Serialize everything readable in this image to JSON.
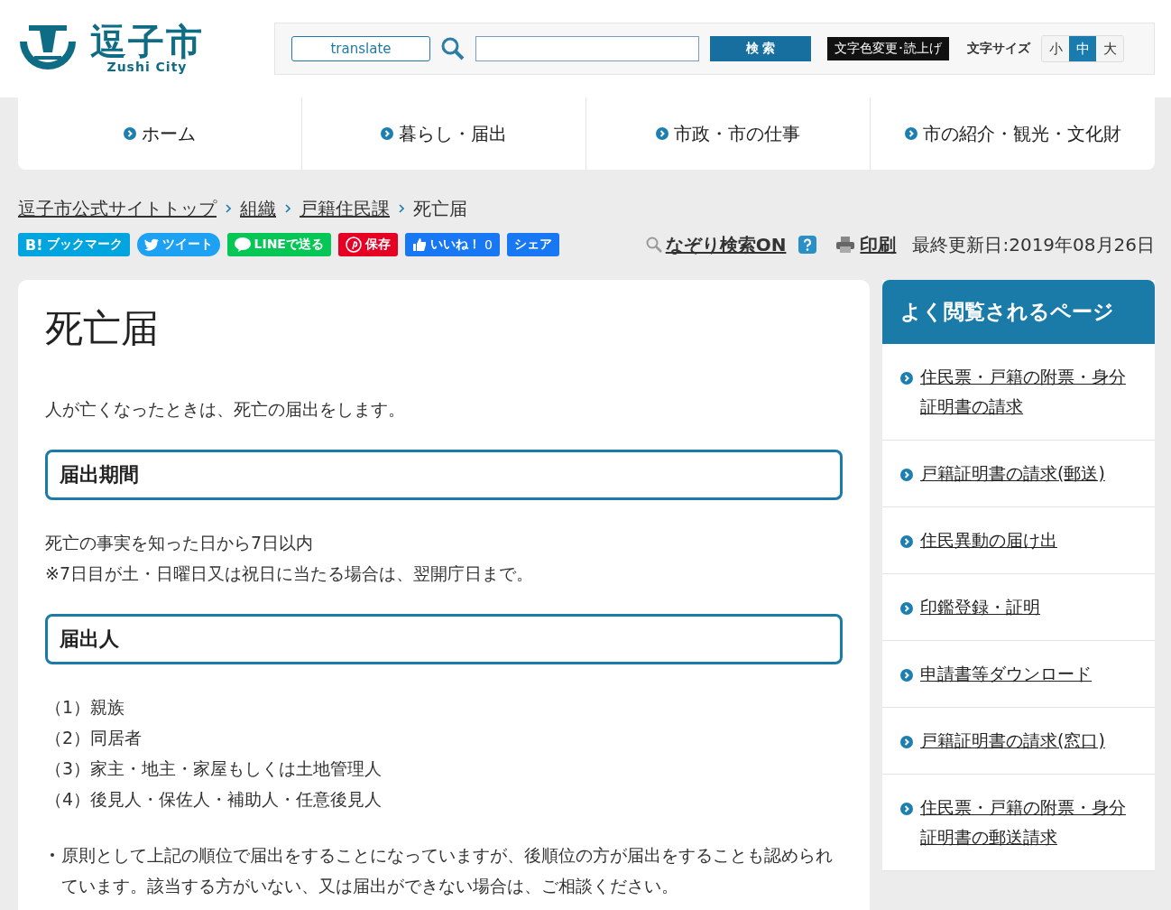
{
  "header": {
    "logo": {
      "name": "逗子市",
      "sub": "Zushi City"
    },
    "translate": "translate",
    "search_button": "検 索",
    "color_button": "文字色変更･読上げ",
    "font_size": {
      "label": "文字サイズ",
      "options": [
        {
          "label": "小",
          "selected": false
        },
        {
          "label": "中",
          "selected": true
        },
        {
          "label": "大",
          "selected": false
        }
      ]
    }
  },
  "nav": [
    "ホーム",
    "暮らし・届出",
    "市政・市の仕事",
    "市の紹介・観光・文化財"
  ],
  "breadcrumb": {
    "links": [
      "逗子市公式サイトトップ",
      "組織",
      "戸籍住民課"
    ],
    "current": "死亡届"
  },
  "share": [
    {
      "kind": "hatena",
      "label": "ブックマーク",
      "mark": "B!"
    },
    {
      "kind": "twitter",
      "label": "ツイート"
    },
    {
      "kind": "line",
      "label": "LINEで送る"
    },
    {
      "kind": "pinterest",
      "label": "保存"
    },
    {
      "kind": "like",
      "label": "いいね！",
      "count": "0"
    },
    {
      "kind": "share",
      "label": "シェア"
    }
  ],
  "tools": {
    "trace_search": "なぞり検索ON",
    "print": "印刷",
    "updated": "最終更新日:2019年08月26日"
  },
  "article": {
    "title": "死亡届",
    "intro": "人が亡くなったときは、死亡の届出をします。",
    "sections": [
      {
        "heading": "届出期間",
        "lines": [
          "死亡の事実を知った日から7日以内",
          "※7日目が土・日曜日又は祝日に当たる場合は、翌開庁日まで。"
        ]
      },
      {
        "heading": "届出人",
        "lines": [
          "（1）親族",
          "（2）同居者",
          "（3）家主・地主・家屋もしくは土地管理人",
          "（4）後見人・保佐人・補助人・任意後見人"
        ]
      }
    ],
    "note": "原則として上記の順位で届出をすることになっていますが、後順位の方が届出をすることも認められています。該当する方がいない、又は届出ができない場合は、ご相談ください。"
  },
  "sidebar": {
    "title": "よく閲覧されるページ",
    "links": [
      "住民票・戸籍の附票・身分証明書の請求",
      "戸籍証明書の請求(郵送)",
      "住民異動の届け出",
      "印鑑登録・証明",
      "申請書等ダウンロード",
      "戸籍証明書の請求(窓口)",
      "住民票・戸籍の附票・身分証明書の郵送請求"
    ]
  }
}
